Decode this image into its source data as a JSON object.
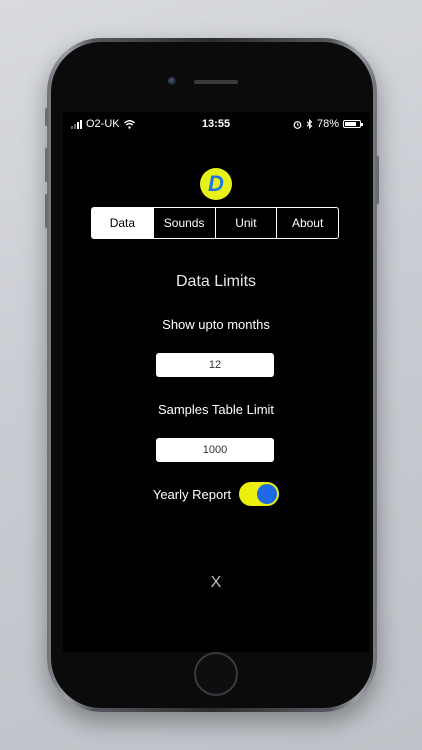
{
  "status_bar": {
    "carrier": "O2-UK",
    "time": "13:55",
    "battery_percent": "78%",
    "battery_level": 0.78,
    "icons": [
      "signal-icon",
      "wifi-icon",
      "alarm-icon",
      "bluetooth-icon",
      "battery-icon"
    ]
  },
  "logo": {
    "letter": "D"
  },
  "tabs": [
    {
      "label": "Data",
      "active": true
    },
    {
      "label": "Sounds",
      "active": false
    },
    {
      "label": "Unit",
      "active": false
    },
    {
      "label": "About",
      "active": false
    }
  ],
  "section": {
    "title": "Data Limits"
  },
  "months": {
    "label": "Show upto months",
    "value": "12"
  },
  "samples": {
    "label": "Samples Table Limit",
    "value": "1000"
  },
  "yearly_report": {
    "label": "Yearly Report",
    "enabled": true
  },
  "close": {
    "label": "X"
  },
  "colors": {
    "accent_yellow": "#ecf00d",
    "accent_blue": "#1d69e6",
    "background": "#000000"
  }
}
